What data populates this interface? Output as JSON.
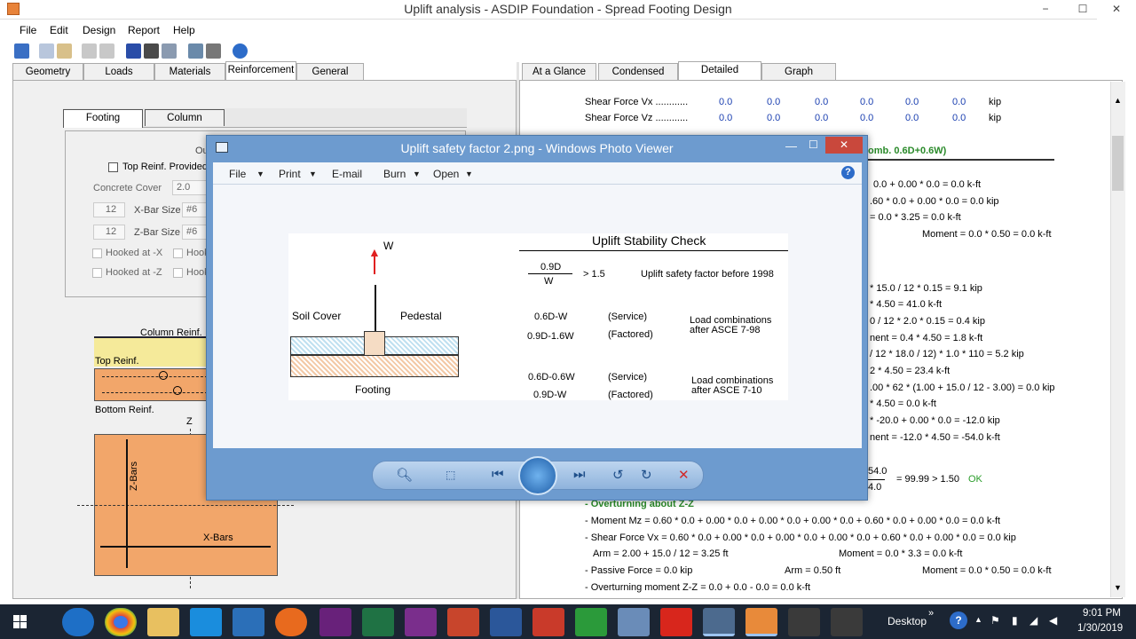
{
  "window": {
    "title": "Uplift analysis - ASDIP Foundation - Spread Footing Design",
    "min": "−",
    "max": "☐",
    "close": "✕"
  },
  "menu": [
    "File",
    "Edit",
    "Design",
    "Report",
    "Help"
  ],
  "left_tabs": [
    "Geometry",
    "Loads",
    "Materials",
    "Reinforcement",
    "General"
  ],
  "sub_tabs": [
    "Footing",
    "Column"
  ],
  "reinf": {
    "group_label": "Ou",
    "top_reinf_label": "Top Reinf. Provided",
    "concrete_cover_label": "Concrete Cover",
    "concrete_cover": "2.0",
    "x_count": "12",
    "x_bar_label": "X-Bar Size",
    "x_bar": "#6",
    "z_count": "12",
    "z_bar_label": "Z-Bar Size",
    "z_bar": "#6",
    "hooked_x": "Hooked at -X",
    "hooked_x2": "Hook",
    "hooked_z": "Hooked at -Z",
    "hooked_z2": "Hook"
  },
  "section": {
    "column_reinf": "Column Reinf.",
    "top_reinf": "Top Reinf.",
    "bottom_reinf": "Bottom Reinf."
  },
  "plan": {
    "z_axis": "Z",
    "z_bars": "Z-Bars",
    "x_bars": "X-Bars"
  },
  "right_tabs": [
    "At a Glance",
    "Condensed",
    "Detailed",
    "Graph"
  ],
  "report": {
    "shear_vx_label": "Shear Force  Vx  ............",
    "shear_vz_label": "Shear Force  Vz  ............",
    "vx_values": [
      "0.0",
      "0.0",
      "0.0",
      "0.0",
      "0.0",
      "0.0"
    ],
    "vz_values": [
      "0.0",
      "0.0",
      "0.0",
      "0.0",
      "0.0",
      "0.0"
    ],
    "unit_kip": "kip",
    "comb_header": "omb. 0.6D+0.6W)",
    "lines_right": [
      "0.0 + 0.00 * 0.0 = 0.0  k-ft",
      ".60 * 0.0 + 0.00 * 0.0 = 0.0  kip",
      "= 0.0 * 3.25 =  0.0  k-ft",
      "Moment = 0.0 * 0.50 =  0.0  k-ft",
      "* 15.0 / 12 * 0.15 = 9.1  kip",
      "* 4.50 = 41.0  k-ft",
      "0 / 12 * 2.0 * 0.15 = 0.4  kip",
      "nent = 0.4 * 4.50 = 1.8  k-ft",
      "/ 12 * 18.0 / 12) * 1.0 * 110 = 5.2  kip",
      "2 * 4.50 = 23.4  k-ft",
      ".00 * 62 * (1.00 + 15.0 / 12 - 3.00) = 0.0  kip",
      "* 4.50 = 0.0  k-ft",
      "* -20.0 + 0.00 * 0.0 = -12.0  kip",
      "nent = -12.0 * 4.50 = -54.0  k-ft"
    ],
    "sf_num": "54.0",
    "sf_den": "4.0",
    "sf_result": "= 99.99  > 1.50",
    "sf_ok": "OK",
    "overturning_zz": "- Overturning about Z-Z",
    "moment_mz": "- Moment  Mz = 0.60 * 0.0 + 0.00 * 0.0 + 0.00 * 0.0 + 0.00 * 0.0 + 0.60 * 0.0 + 0.00 * 0.0 = 0.0  k-ft",
    "shear_vx": "- Shear Force  Vx = 0.60 * 0.0 + 0.00 * 0.0 + 0.00 * 0.0 + 0.00 * 0.0 + 0.60 * 0.0 + 0.00 * 0.0 = 0.0  kip",
    "arm": "Arm = 2.00 + 15.0 / 12 = 3.25  ft",
    "arm_moment": "Moment = 0.0 * 3.3 =  0.0  k-ft",
    "passive": "- Passive Force = 0.0  kip",
    "passive_arm": "Arm = 0.50  ft",
    "passive_moment": "Moment = 0.0 * 0.50 =  0.0  k-ft",
    "ot_moment": "- Overturning moment Z-Z = 0.0 + 0.0 - 0.0 = 0.0  k-ft"
  },
  "viewer": {
    "title": "Uplift safety factor 2.png - Windows Photo Viewer",
    "menu": [
      "File",
      "Print",
      "E-mail",
      "Burn",
      "Open"
    ],
    "help": "?",
    "image": {
      "w_label": "W",
      "soil_cover": "Soil Cover",
      "pedestal": "Pedestal",
      "footing": "Footing",
      "check_title": "Uplift Stability Check",
      "frac_num": "0.9D",
      "frac_den": "W",
      "frac_cond": "> 1.5",
      "frac_note": "Uplift safety factor before 1998",
      "c1a": "0.6D-W",
      "c1a_t": "(Service)",
      "c1b": "0.9D-1.6W",
      "c1b_t": "(Factored)",
      "c1_note1": "Load combinations",
      "c1_note2": "after ASCE 7-98",
      "c2a": "0.6D-0.6W",
      "c2a_t": "(Service)",
      "c2b": "0.9D-W",
      "c2b_t": "(Factored)",
      "c2_note1": "Load combinations",
      "c2_note2": "after ASCE 7-10"
    }
  },
  "taskbar": {
    "desktop": "Desktop",
    "time": "9:01 PM",
    "date": "1/30/2019"
  }
}
